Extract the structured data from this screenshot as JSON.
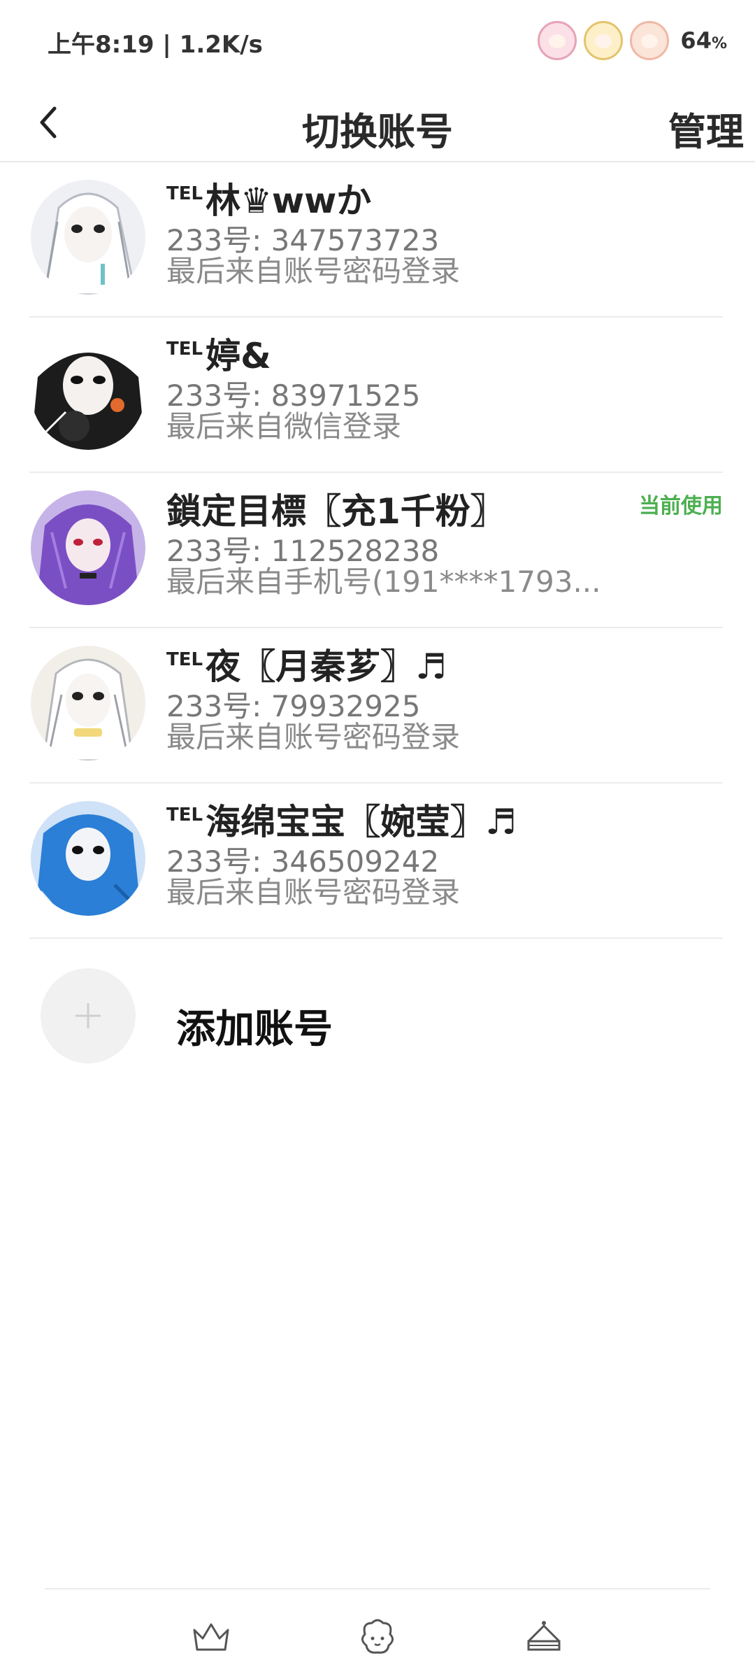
{
  "status_bar": {
    "time": "上午8:19 | 1.2K/s",
    "battery": "64",
    "battery_unit": "%",
    "icons": [
      "hd-sheep-icon",
      "signal-sheep-icon",
      "battery-sheep-icon"
    ]
  },
  "header": {
    "back_icon": "chevron-left-icon",
    "title": "切换账号",
    "manage_label": "管理"
  },
  "accounts": [
    {
      "tel_tag": "TEL",
      "name": "林♛wwか",
      "id_text": "233号: 347573723",
      "login_text": "最后来自账号密码登录",
      "current": false,
      "avatar_color": "#eef0f4"
    },
    {
      "tel_tag": "TEL",
      "name": "婷&",
      "id_text": "233号: 83971525",
      "login_text": "最后来自微信登录",
      "current": false,
      "avatar_color": "#1c1c1c"
    },
    {
      "tel_tag": "",
      "name": "鎖定目標〖充1千粉〗",
      "id_text": "233号: 112528238",
      "login_text": "最后来自手机号(191****1793...",
      "current": true,
      "current_label": "当前使用",
      "avatar_color": "#7b4fc4"
    },
    {
      "tel_tag": "TEL",
      "name": "夜〖月秦芗〗♬",
      "id_text": "233号: 79932925",
      "login_text": "最后来自账号密码登录",
      "current": false,
      "avatar_color": "#f1efe8"
    },
    {
      "tel_tag": "TEL",
      "name": "海绵宝宝〖婉莹〗♬",
      "id_text": "233号: 346509242",
      "login_text": "最后来自账号密码登录",
      "current": false,
      "avatar_color": "#2b7fd6"
    }
  ],
  "add_account": {
    "label": "添加账号",
    "icon": "plus-icon"
  },
  "bottom_nav": {
    "items": [
      "crown-icon",
      "sheep-face-icon",
      "cake-icon"
    ]
  },
  "colors": {
    "current_badge": "#4caf50",
    "divider": "#ececec",
    "secondary_text": "#8a8a8a"
  }
}
